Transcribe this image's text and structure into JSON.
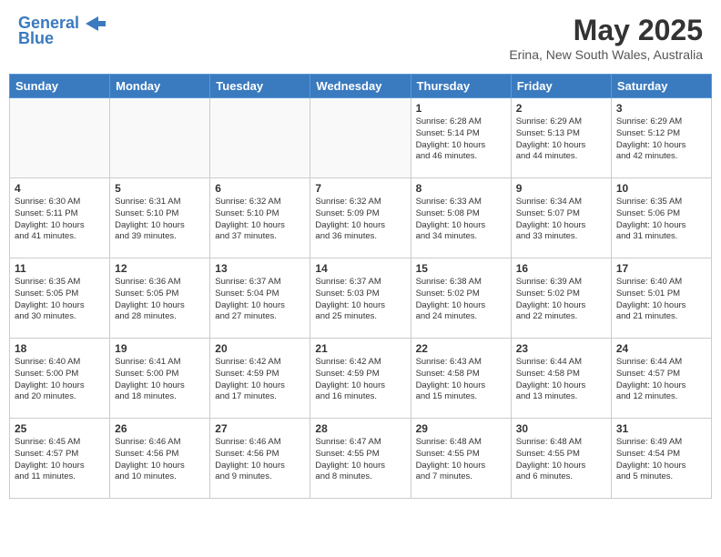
{
  "header": {
    "logo_general": "General",
    "logo_blue": "Blue",
    "month_title": "May 2025",
    "subtitle": "Erina, New South Wales, Australia"
  },
  "calendar": {
    "days_of_week": [
      "Sunday",
      "Monday",
      "Tuesday",
      "Wednesday",
      "Thursday",
      "Friday",
      "Saturday"
    ],
    "weeks": [
      [
        {
          "day": "",
          "info": ""
        },
        {
          "day": "",
          "info": ""
        },
        {
          "day": "",
          "info": ""
        },
        {
          "day": "",
          "info": ""
        },
        {
          "day": "1",
          "info": "Sunrise: 6:28 AM\nSunset: 5:14 PM\nDaylight: 10 hours\nand 46 minutes."
        },
        {
          "day": "2",
          "info": "Sunrise: 6:29 AM\nSunset: 5:13 PM\nDaylight: 10 hours\nand 44 minutes."
        },
        {
          "day": "3",
          "info": "Sunrise: 6:29 AM\nSunset: 5:12 PM\nDaylight: 10 hours\nand 42 minutes."
        }
      ],
      [
        {
          "day": "4",
          "info": "Sunrise: 6:30 AM\nSunset: 5:11 PM\nDaylight: 10 hours\nand 41 minutes."
        },
        {
          "day": "5",
          "info": "Sunrise: 6:31 AM\nSunset: 5:10 PM\nDaylight: 10 hours\nand 39 minutes."
        },
        {
          "day": "6",
          "info": "Sunrise: 6:32 AM\nSunset: 5:10 PM\nDaylight: 10 hours\nand 37 minutes."
        },
        {
          "day": "7",
          "info": "Sunrise: 6:32 AM\nSunset: 5:09 PM\nDaylight: 10 hours\nand 36 minutes."
        },
        {
          "day": "8",
          "info": "Sunrise: 6:33 AM\nSunset: 5:08 PM\nDaylight: 10 hours\nand 34 minutes."
        },
        {
          "day": "9",
          "info": "Sunrise: 6:34 AM\nSunset: 5:07 PM\nDaylight: 10 hours\nand 33 minutes."
        },
        {
          "day": "10",
          "info": "Sunrise: 6:35 AM\nSunset: 5:06 PM\nDaylight: 10 hours\nand 31 minutes."
        }
      ],
      [
        {
          "day": "11",
          "info": "Sunrise: 6:35 AM\nSunset: 5:05 PM\nDaylight: 10 hours\nand 30 minutes."
        },
        {
          "day": "12",
          "info": "Sunrise: 6:36 AM\nSunset: 5:05 PM\nDaylight: 10 hours\nand 28 minutes."
        },
        {
          "day": "13",
          "info": "Sunrise: 6:37 AM\nSunset: 5:04 PM\nDaylight: 10 hours\nand 27 minutes."
        },
        {
          "day": "14",
          "info": "Sunrise: 6:37 AM\nSunset: 5:03 PM\nDaylight: 10 hours\nand 25 minutes."
        },
        {
          "day": "15",
          "info": "Sunrise: 6:38 AM\nSunset: 5:02 PM\nDaylight: 10 hours\nand 24 minutes."
        },
        {
          "day": "16",
          "info": "Sunrise: 6:39 AM\nSunset: 5:02 PM\nDaylight: 10 hours\nand 22 minutes."
        },
        {
          "day": "17",
          "info": "Sunrise: 6:40 AM\nSunset: 5:01 PM\nDaylight: 10 hours\nand 21 minutes."
        }
      ],
      [
        {
          "day": "18",
          "info": "Sunrise: 6:40 AM\nSunset: 5:00 PM\nDaylight: 10 hours\nand 20 minutes."
        },
        {
          "day": "19",
          "info": "Sunrise: 6:41 AM\nSunset: 5:00 PM\nDaylight: 10 hours\nand 18 minutes."
        },
        {
          "day": "20",
          "info": "Sunrise: 6:42 AM\nSunset: 4:59 PM\nDaylight: 10 hours\nand 17 minutes."
        },
        {
          "day": "21",
          "info": "Sunrise: 6:42 AM\nSunset: 4:59 PM\nDaylight: 10 hours\nand 16 minutes."
        },
        {
          "day": "22",
          "info": "Sunrise: 6:43 AM\nSunset: 4:58 PM\nDaylight: 10 hours\nand 15 minutes."
        },
        {
          "day": "23",
          "info": "Sunrise: 6:44 AM\nSunset: 4:58 PM\nDaylight: 10 hours\nand 13 minutes."
        },
        {
          "day": "24",
          "info": "Sunrise: 6:44 AM\nSunset: 4:57 PM\nDaylight: 10 hours\nand 12 minutes."
        }
      ],
      [
        {
          "day": "25",
          "info": "Sunrise: 6:45 AM\nSunset: 4:57 PM\nDaylight: 10 hours\nand 11 minutes."
        },
        {
          "day": "26",
          "info": "Sunrise: 6:46 AM\nSunset: 4:56 PM\nDaylight: 10 hours\nand 10 minutes."
        },
        {
          "day": "27",
          "info": "Sunrise: 6:46 AM\nSunset: 4:56 PM\nDaylight: 10 hours\nand 9 minutes."
        },
        {
          "day": "28",
          "info": "Sunrise: 6:47 AM\nSunset: 4:55 PM\nDaylight: 10 hours\nand 8 minutes."
        },
        {
          "day": "29",
          "info": "Sunrise: 6:48 AM\nSunset: 4:55 PM\nDaylight: 10 hours\nand 7 minutes."
        },
        {
          "day": "30",
          "info": "Sunrise: 6:48 AM\nSunset: 4:55 PM\nDaylight: 10 hours\nand 6 minutes."
        },
        {
          "day": "31",
          "info": "Sunrise: 6:49 AM\nSunset: 4:54 PM\nDaylight: 10 hours\nand 5 minutes."
        }
      ]
    ]
  }
}
